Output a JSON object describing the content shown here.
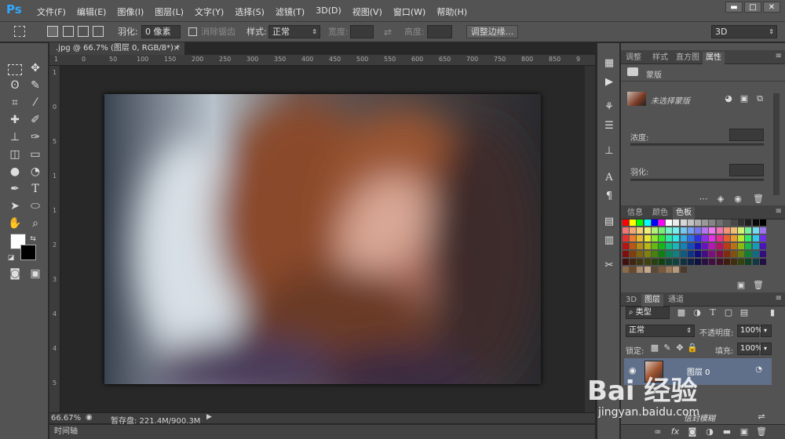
{
  "app": {
    "logo": "Ps"
  },
  "menu": [
    "文件(F)",
    "编辑(E)",
    "图像(I)",
    "图层(L)",
    "文字(Y)",
    "选择(S)",
    "滤镜(T)",
    "3D(D)",
    "视图(V)",
    "窗口(W)",
    "帮助(H)"
  ],
  "window_controls": {
    "minimize": "▬",
    "maximize": "□",
    "close": "✕"
  },
  "options": {
    "feather_label": "羽化:",
    "feather_value": "0 像素",
    "antialias_label": "消除锯齿",
    "style_label": "样式:",
    "style_value": "正常",
    "width_label": "宽度:",
    "height_label": "高度:",
    "refine_edge_button": "调整边缘...",
    "workspace_value": "3D"
  },
  "document": {
    "tab_title": ".jpg @ 66.7% (图层 0, RGB/8*) *",
    "zoom": "66.67%",
    "scratch_label": "暂存盘: 221.4M/900.3M",
    "timeline": "时间轴"
  },
  "ruler_h_ticks": [
    "1",
    "0",
    "50",
    "100",
    "150",
    "200",
    "250",
    "300",
    "350",
    "400",
    "450",
    "500",
    "550",
    "600",
    "650",
    "700",
    "750",
    "800",
    "850",
    "9"
  ],
  "ruler_v_ticks": [
    "1",
    "0",
    "5",
    "1",
    "1",
    "2",
    "3",
    "4",
    "4",
    "5"
  ],
  "properties_panel": {
    "tabs": [
      "调整",
      "样式",
      "直方图",
      "属性"
    ],
    "active_tab": "属性",
    "mask_title": "蒙版",
    "no_selection_text": "未选择蒙版",
    "density_label": "浓度:",
    "feather_label": "羽化:"
  },
  "swatches_panel": {
    "tabs": [
      "信息",
      "颜色",
      "色板"
    ],
    "active_tab": "色板"
  },
  "layers_panel": {
    "tabs": [
      "3D",
      "图层",
      "通道"
    ],
    "active_tab": "图层",
    "filter_label": "类型",
    "blend_mode": "正常",
    "opacity_label": "不透明度:",
    "opacity_value": "100%",
    "lock_label": "锁定:",
    "fill_label": "填充:",
    "fill_value": "100%",
    "layer_name": "图层 0",
    "secondary_text": "信封模糊"
  },
  "watermark": {
    "brand": "Bai 经验",
    "url": "jingyan.baidu.com"
  },
  "colors": {
    "ui_dark": "#535353",
    "canvas_bg": "#282828",
    "accent": "#31a8ff",
    "layer_selected": "#61708a"
  }
}
